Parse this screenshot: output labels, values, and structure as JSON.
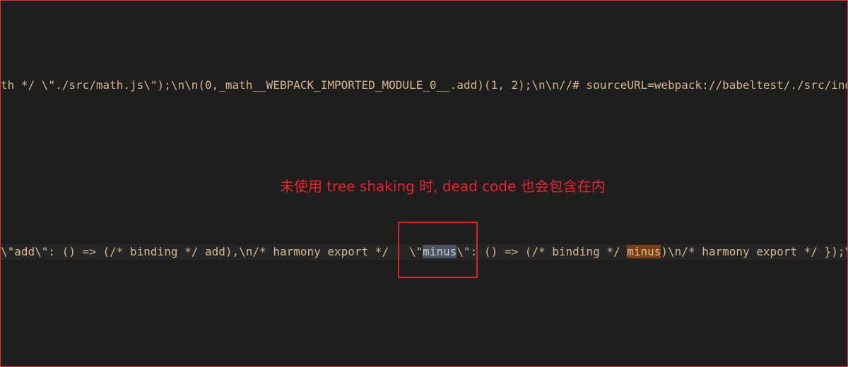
{
  "editor": {
    "line_1": "th */ \\\"./src/math.js\\\");\\n\\n(0,_math__WEBPACK_IMPORTED_MODULE_0__.add)(1, 2);\\n\\n//# sourceURL=webpack://babeltest/./src/index",
    "line_2": {
      "before": "\\\"add\\\": () => (/* binding */ add),\\n/* harmony export */   \\\"",
      "selected": "minus",
      "middle": "\\\": () => (/* binding */ ",
      "found": "minus",
      "after": ")\\n/* harmony export */ });\\n"
    }
  },
  "annotation": {
    "text": "未使用 tree shaking 时, dead code 也会包含在内"
  },
  "colors": {
    "background": "#1e1e1e",
    "code_text": "#d4b88c",
    "selection": "#4a5563",
    "find_match": "#7b3f16",
    "annotation_red": "#e8232b"
  }
}
